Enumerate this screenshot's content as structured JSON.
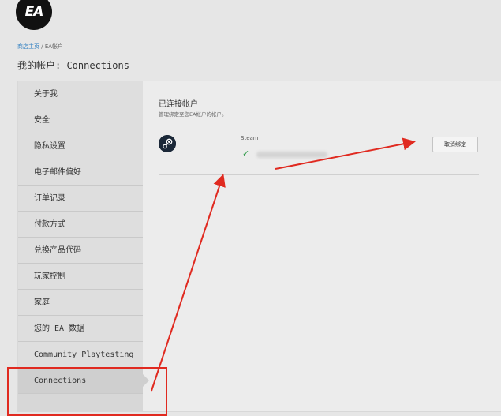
{
  "brand": {
    "logo_text": "EA"
  },
  "breadcrumb": {
    "home": "商店主页",
    "separator": "/",
    "current": "EA帐户"
  },
  "page": {
    "title": "我的帐户: Connections"
  },
  "sidebar": {
    "items": [
      {
        "label": "关于我"
      },
      {
        "label": "安全"
      },
      {
        "label": "隐私设置"
      },
      {
        "label": "电子邮件偏好"
      },
      {
        "label": "订单记录"
      },
      {
        "label": "付款方式"
      },
      {
        "label": "兑换产品代码"
      },
      {
        "label": "玩家控制"
      },
      {
        "label": "家庭"
      },
      {
        "label": "您的 EA 数据"
      },
      {
        "label": "Community Playtesting"
      },
      {
        "label": "Connections"
      }
    ],
    "active_index": 11
  },
  "connections": {
    "title": "已连接帐户",
    "description": "管理绑定至您EA帐户的帐户。",
    "accounts": [
      {
        "name": "Steam",
        "icon": "steam-icon",
        "status_icon": "check-icon",
        "unlink_label": "取消绑定"
      }
    ]
  },
  "colors": {
    "accent_link": "#2f7fc1",
    "annotation_red": "#e02a20",
    "check_green": "#2e9a48"
  }
}
